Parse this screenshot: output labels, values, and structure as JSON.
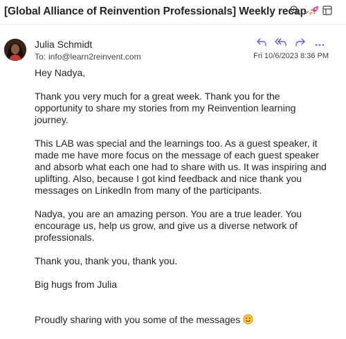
{
  "email": {
    "subject": "[Global Alliance of Reinvention Professionals] Weekly recap",
    "subject_icon": "rocket-emoji",
    "sender": "Julia Schmidt",
    "to_label": "To:",
    "to_address": "info@learn2reinvent.com",
    "date": "Fri 10/6/2023 8:36 PM",
    "actions": [
      "reply-icon",
      "reply-all-icon",
      "forward-icon",
      "more-icon"
    ],
    "header_tools": [
      "zoom-icon",
      "chevron-down-icon",
      "popout-icon"
    ],
    "accent_color": "#5b5fc7"
  },
  "body": {
    "greeting": "Hey Nadya,",
    "p1": "Thank you very much for a great week. Thank you for the opportunity to share my stories from my Reinvention learning journey.",
    "p2": "This LAB was special and the learnings too.  As a guest speaker, it made me have more focus on the message of each guest speaker and absorb what each one had to share with us.  It was inspiring and uplifting. Also, because I got kind feedback and nice thank you messages on LinkedIn from many of the participants.",
    "p3": "Nadya, you are an amazing person. You are a true leader. You encourage us, help us grow, and give us a diverse network of professionals.",
    "p4": "Thank you, thank you, thank you.",
    "p5": "Big hugs from Julia",
    "p6": "Proudly sharing with you some of the messages",
    "p6_icon": "smiley-emoji"
  }
}
